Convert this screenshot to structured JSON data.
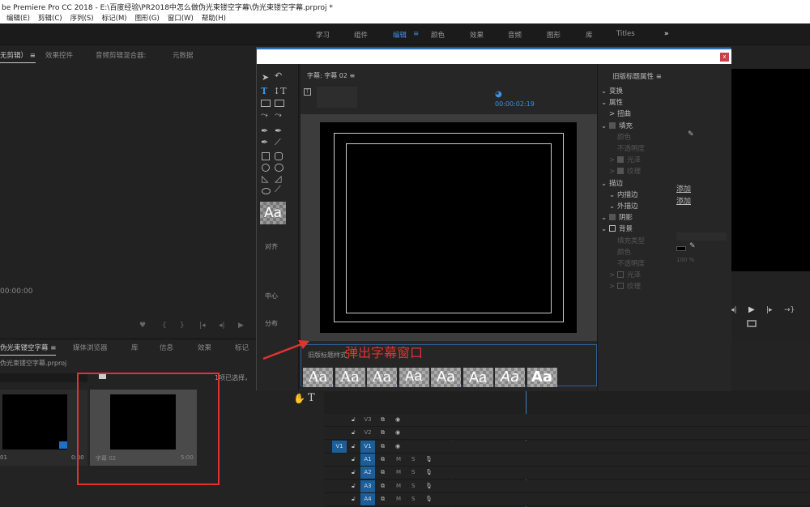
{
  "window": {
    "title": "be Premiere Pro CC 2018 - E:\\百度经验\\PR2018中怎么做伪光束镂空字幕\\伪光束镂空字幕.prproj *"
  },
  "menu": [
    "编辑(E)",
    "剪辑(C)",
    "序列(S)",
    "标记(M)",
    "图形(G)",
    "窗口(W)",
    "帮助(H)"
  ],
  "workspaces": {
    "items": [
      "学习",
      "组件",
      "编辑",
      "颜色",
      "效果",
      "音频",
      "图形",
      "库",
      "Titles"
    ],
    "active": "编辑",
    "more": "»"
  },
  "source_panel": {
    "tabs": [
      "无剪辑）",
      "效果控件",
      "音频剪辑混合器:",
      "元数据"
    ],
    "timecode": "00:00:00",
    "controls": [
      "♥",
      "{",
      "}",
      "|◂",
      "◂|",
      "▶"
    ]
  },
  "project_panel": {
    "tabs": [
      "伪光束镂空字幕",
      "媒体浏览器",
      "库",
      "信息",
      "效果",
      "标记"
    ],
    "path": "伪光束镂空字幕.prproj",
    "selection": "1项已选择，",
    "items": [
      {
        "name": "01",
        "duration": "0:00"
      },
      {
        "name": "字幕 02",
        "duration": "5:00"
      }
    ]
  },
  "titler": {
    "close": "x",
    "title": "字幕: 字幕 02",
    "timecode": "00:00:02:19",
    "tools": {
      "align_label": "对齐",
      "center_label": "中心",
      "distribute_label": "分布",
      "style_preview": "Aa"
    },
    "styles": {
      "label": "旧版标题样式",
      "tiles": [
        "Aa",
        "Aa",
        "Aa",
        "Aa",
        "Aa",
        "Aa",
        "Aa",
        "Aa"
      ]
    },
    "properties": {
      "title": "旧版标题属性",
      "rows": [
        "变换",
        "属性",
        "扭曲",
        "填充",
        "颜色",
        "不透明度",
        "光泽",
        "纹理",
        "描边",
        "内描边",
        "外描边",
        "阴影",
        "背景",
        "填充类型",
        "颜色",
        "不透明度",
        "光泽",
        "纹理"
      ],
      "add": "添加",
      "opacity_value": "100 %"
    }
  },
  "annotation": {
    "text": "弹出字幕窗口",
    "color": "#e0342f"
  },
  "timeline": {
    "tracks": [
      "V3",
      "V2",
      "V1",
      "A1",
      "A2",
      "A3",
      "A4"
    ],
    "source_patch": "V1",
    "mute": "M",
    "solo": "S"
  },
  "colors": {
    "accent": "#2d8ceb",
    "annotation": "#e0342f",
    "close": "#c9414a"
  }
}
